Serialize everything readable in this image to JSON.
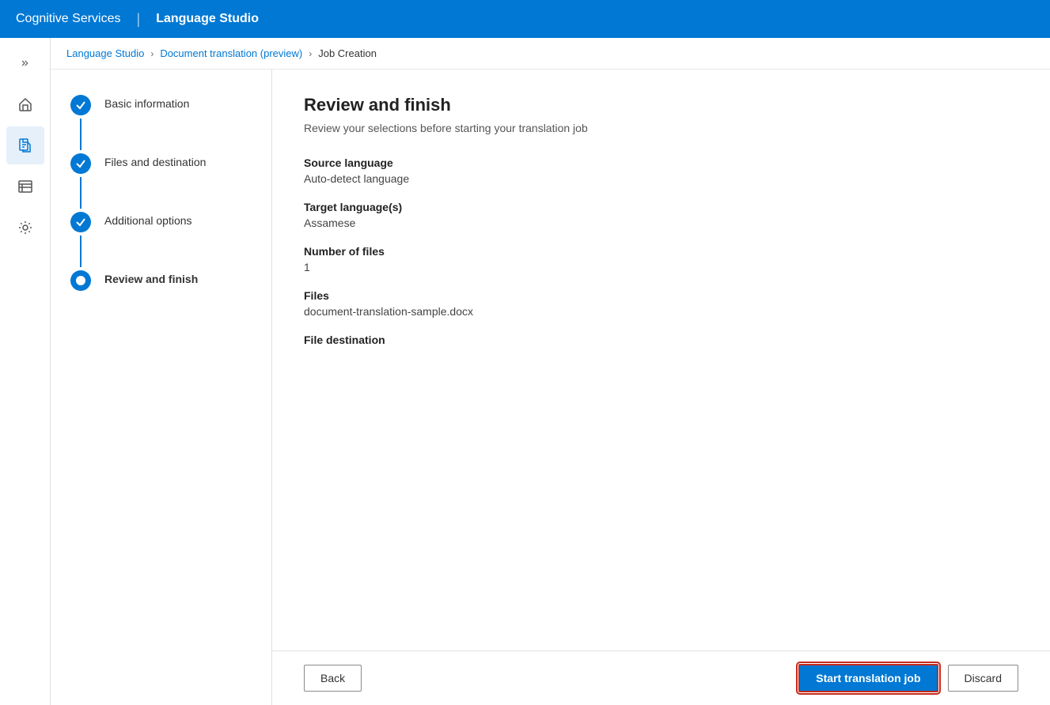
{
  "header": {
    "brand": "Cognitive Services",
    "divider": "|",
    "app_title": "Language Studio"
  },
  "breadcrumb": {
    "items": [
      {
        "label": "Language Studio",
        "link": true
      },
      {
        "label": "Document translation (preview)",
        "link": true
      },
      {
        "label": "Job Creation",
        "link": false
      }
    ]
  },
  "wizard": {
    "steps": [
      {
        "id": "basic-information",
        "label": "Basic information",
        "state": "completed"
      },
      {
        "id": "files-and-destination",
        "label": "Files and destination",
        "state": "completed"
      },
      {
        "id": "additional-options",
        "label": "Additional options",
        "state": "completed"
      },
      {
        "id": "review-and-finish",
        "label": "Review and finish",
        "state": "active"
      }
    ]
  },
  "review": {
    "title": "Review and finish",
    "subtitle": "Review your selections before starting your translation job",
    "sections": [
      {
        "label": "Source language",
        "value": "Auto-detect language"
      },
      {
        "label": "Target language(s)",
        "value": "Assamese"
      },
      {
        "label": "Number of files",
        "value": "1"
      },
      {
        "label": "Files",
        "value": "document-translation-sample.docx"
      },
      {
        "label": "File destination",
        "value": ""
      }
    ]
  },
  "footer": {
    "back_label": "Back",
    "start_label": "Start translation job",
    "discard_label": "Discard"
  },
  "sidebar": {
    "icons": [
      {
        "name": "expand-icon",
        "symbol": "»"
      },
      {
        "name": "home-icon",
        "title": "Home"
      },
      {
        "name": "document-icon",
        "title": "Document"
      },
      {
        "name": "list-icon",
        "title": "List"
      },
      {
        "name": "settings-icon",
        "title": "Settings"
      }
    ]
  }
}
